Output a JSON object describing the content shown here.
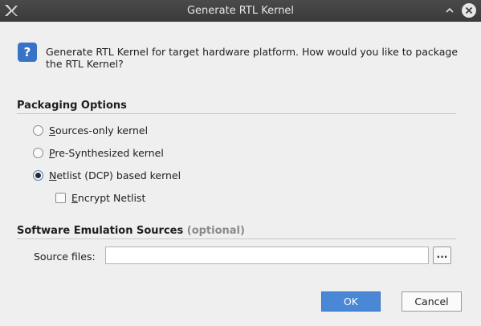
{
  "window": {
    "title": "Generate RTL Kernel",
    "logo_icon": "xilinx-logo",
    "maximize_icon": "chevron-up-icon",
    "close_icon": "close-icon"
  },
  "message": {
    "icon": "question-icon",
    "icon_glyph": "?",
    "text": "Generate RTL Kernel for target hardware platform. How would you like to package the RTL Kernel?"
  },
  "packaging": {
    "title": "Packaging Options",
    "options": [
      {
        "mnemonic": "S",
        "rest": "ources-only kernel",
        "selected": false
      },
      {
        "mnemonic": "P",
        "rest": "re-Synthesized kernel",
        "selected": false
      },
      {
        "mnemonic": "N",
        "rest": "etlist (DCP) based kernel",
        "selected": true
      }
    ],
    "encrypt": {
      "mnemonic": "E",
      "rest": "ncrypt Netlist",
      "checked": false
    }
  },
  "emulation": {
    "title": "Software Emulation Sources",
    "optional": "(optional)",
    "source_label": "Source files:",
    "source_value": "",
    "browse_label": "..."
  },
  "buttons": {
    "ok": "OK",
    "cancel": "Cancel"
  },
  "colors": {
    "accent": "#3874c6",
    "ok_button": "#4a88d6",
    "titlebar": "#3b3b3b",
    "background": "#efefef"
  }
}
